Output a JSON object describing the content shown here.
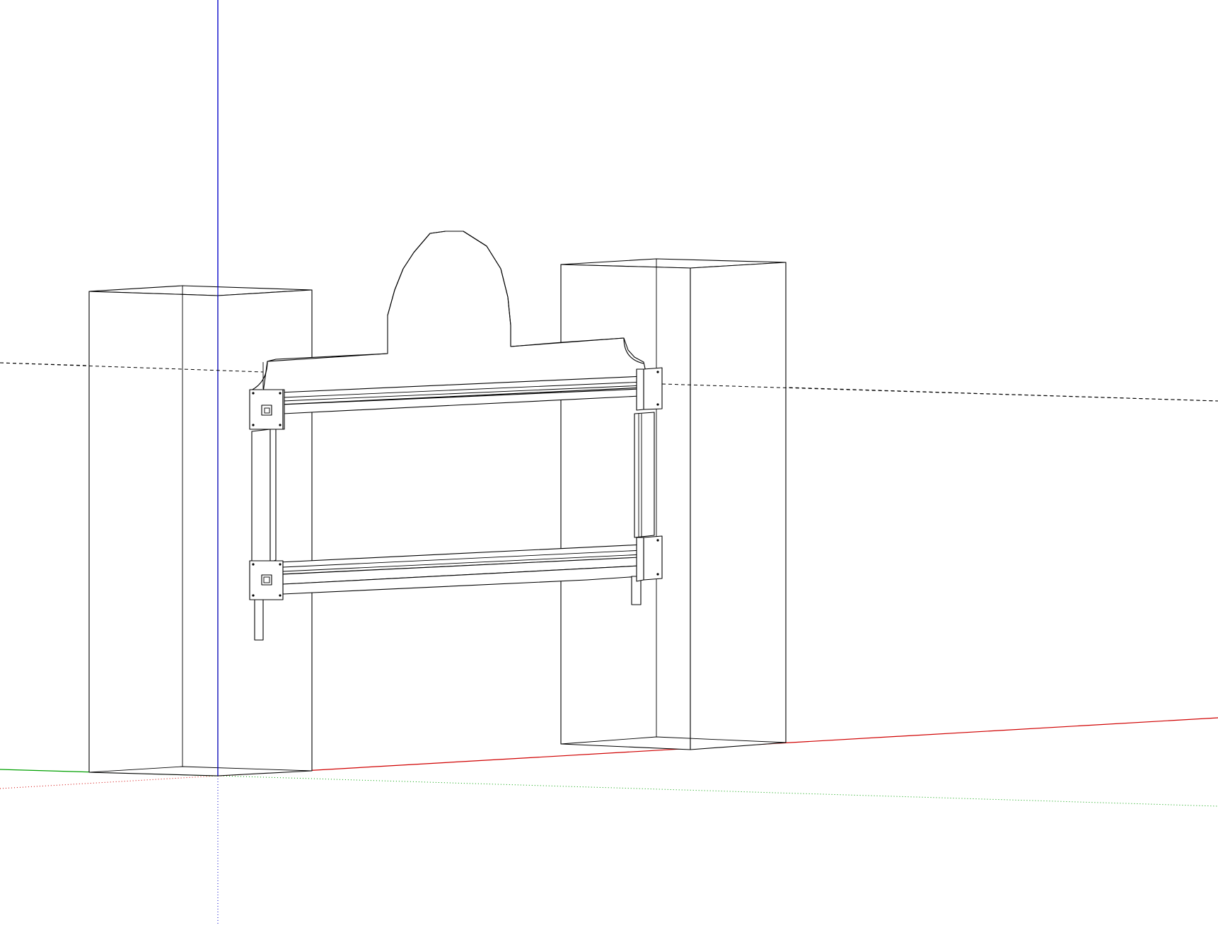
{
  "app": {
    "type": "3d-modeling-viewport",
    "background": "#ffffff"
  },
  "axes": {
    "red_axis_color": "#d00000",
    "green_axis_color": "#00a000",
    "blue_axis_color": "#0000c8"
  },
  "scene": {
    "edge_color": "#000000",
    "guide_lines": "dashed",
    "objects": [
      "left-pillar",
      "right-pillar",
      "arched-sign-panel",
      "frame-brackets",
      "bottom-legs"
    ]
  }
}
